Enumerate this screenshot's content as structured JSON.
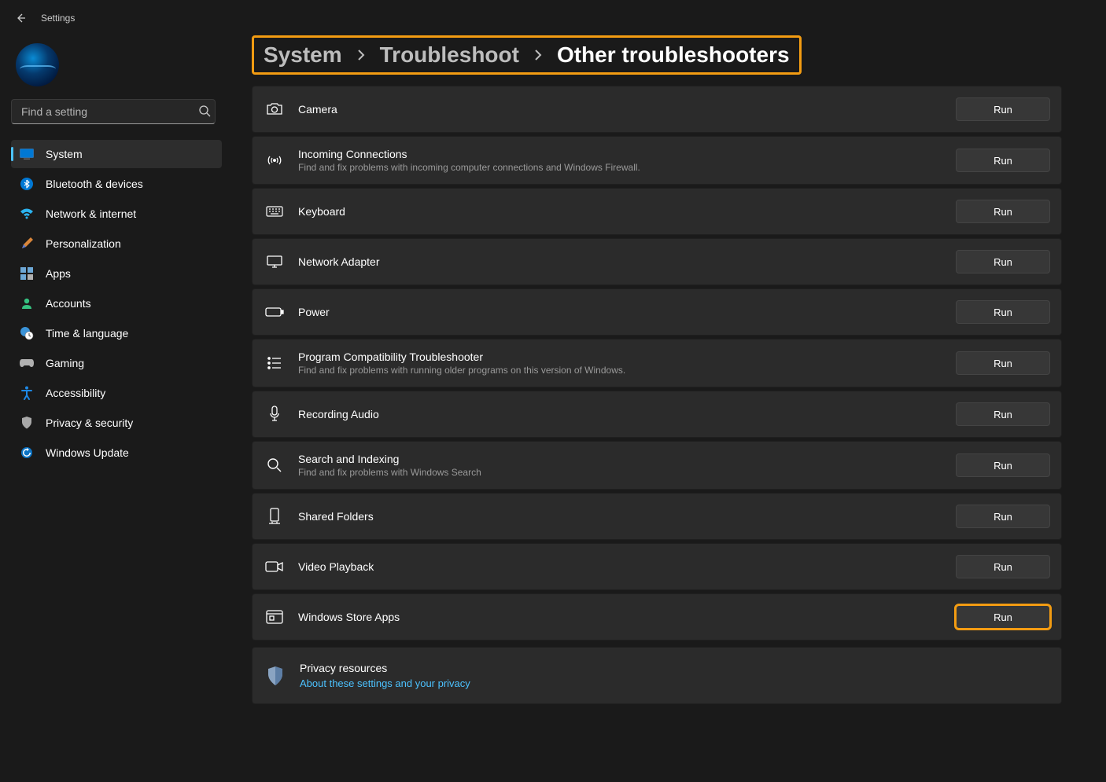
{
  "app": {
    "title": "Settings"
  },
  "search": {
    "placeholder": "Find a setting"
  },
  "sidebar": {
    "items": [
      {
        "id": "system",
        "label": "System"
      },
      {
        "id": "bluetooth",
        "label": "Bluetooth & devices"
      },
      {
        "id": "network",
        "label": "Network & internet"
      },
      {
        "id": "personalization",
        "label": "Personalization"
      },
      {
        "id": "apps",
        "label": "Apps"
      },
      {
        "id": "accounts",
        "label": "Accounts"
      },
      {
        "id": "time",
        "label": "Time & language"
      },
      {
        "id": "gaming",
        "label": "Gaming"
      },
      {
        "id": "accessibility",
        "label": "Accessibility"
      },
      {
        "id": "privacy",
        "label": "Privacy & security"
      },
      {
        "id": "update",
        "label": "Windows Update"
      }
    ]
  },
  "breadcrumb": {
    "items": [
      {
        "label": "System"
      },
      {
        "label": "Troubleshoot"
      }
    ],
    "current": "Other troubleshooters"
  },
  "buttons": {
    "run": "Run"
  },
  "troubleshooters": [
    {
      "id": "camera",
      "title": "Camera",
      "desc": ""
    },
    {
      "id": "incoming",
      "title": "Incoming Connections",
      "desc": "Find and fix problems with incoming computer connections and Windows Firewall."
    },
    {
      "id": "keyboard",
      "title": "Keyboard",
      "desc": ""
    },
    {
      "id": "netadapter",
      "title": "Network Adapter",
      "desc": ""
    },
    {
      "id": "power",
      "title": "Power",
      "desc": ""
    },
    {
      "id": "compat",
      "title": "Program Compatibility Troubleshooter",
      "desc": "Find and fix problems with running older programs on this version of Windows."
    },
    {
      "id": "recaudio",
      "title": "Recording Audio",
      "desc": ""
    },
    {
      "id": "search",
      "title": "Search and Indexing",
      "desc": "Find and fix problems with Windows Search"
    },
    {
      "id": "shared",
      "title": "Shared Folders",
      "desc": ""
    },
    {
      "id": "video",
      "title": "Video Playback",
      "desc": ""
    },
    {
      "id": "store",
      "title": "Windows Store Apps",
      "desc": ""
    }
  ],
  "privacy": {
    "title": "Privacy resources",
    "link": "About these settings and your privacy"
  },
  "colors": {
    "accent": "#4cc2ff",
    "highlight": "#f39c12"
  }
}
